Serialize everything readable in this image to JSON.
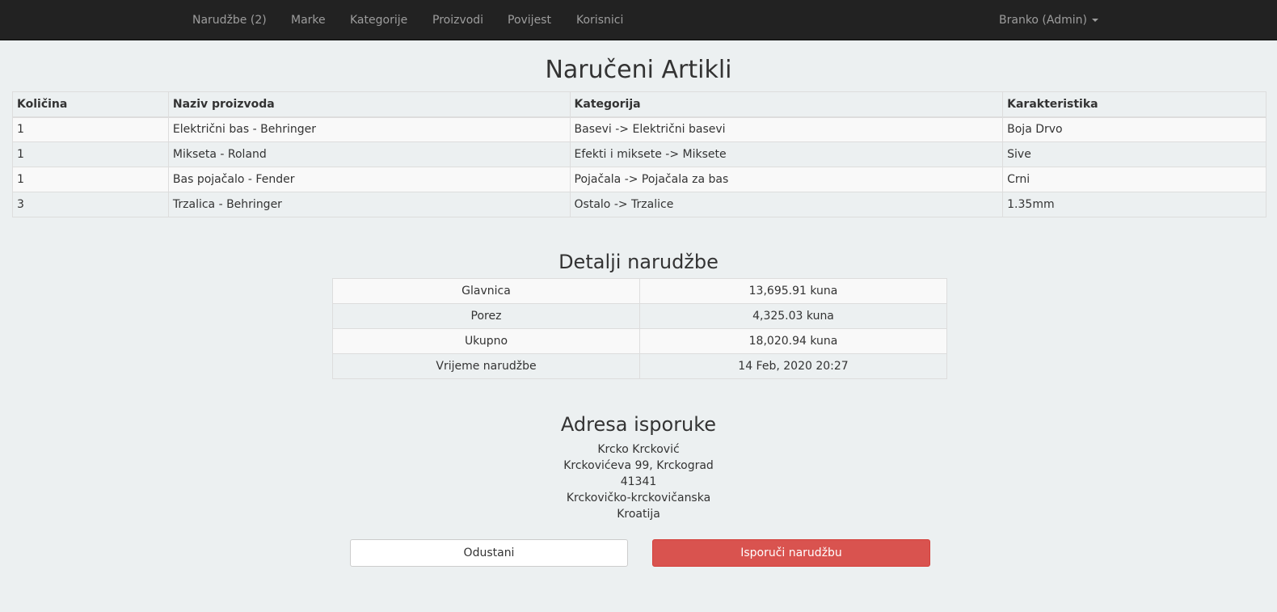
{
  "navbar": {
    "items": [
      {
        "label": "Narudžbe (2)"
      },
      {
        "label": "Marke"
      },
      {
        "label": "Kategorije"
      },
      {
        "label": "Proizvodi"
      },
      {
        "label": "Povijest"
      },
      {
        "label": "Korisnici"
      }
    ],
    "user_label": "Branko (Admin)"
  },
  "page_title": "Naručeni Artikli",
  "items_table": {
    "headers": [
      "Količina",
      "Naziv proizvoda",
      "Kategorija",
      "Karakteristika"
    ],
    "rows": [
      [
        "1",
        "Električni bas - Behringer",
        "Basevi -> Električni basevi",
        "Boja Drvo"
      ],
      [
        "1",
        "Mikseta - Roland",
        "Efekti i miksete -> Miksete",
        "Sive"
      ],
      [
        "1",
        "Bas pojačalo - Fender",
        "Pojačala -> Pojačala za bas",
        "Crni"
      ],
      [
        "3",
        "Trzalica - Behringer",
        "Ostalo -> Trzalice",
        "1.35mm"
      ]
    ]
  },
  "details": {
    "title": "Detalji narudžbe",
    "rows": [
      [
        "Glavnica",
        "13,695.91 kuna"
      ],
      [
        "Porez",
        "4,325.03 kuna"
      ],
      [
        "Ukupno",
        "18,020.94 kuna"
      ],
      [
        "Vrijeme narudžbe",
        "14 Feb, 2020 20:27"
      ]
    ]
  },
  "shipping": {
    "title": "Adresa isporuke",
    "lines": [
      "Krcko Krcković",
      "Krckovićeva 99, Krckograd",
      "41341",
      "Krckovičko-krckovičanska",
      "Kroatija"
    ]
  },
  "actions": {
    "cancel_label": "Odustani",
    "ship_label": "Isporuči narudžbu"
  },
  "colors": {
    "navbar": "#222222",
    "background": "#ecf0f1",
    "danger": "#d9534f"
  }
}
